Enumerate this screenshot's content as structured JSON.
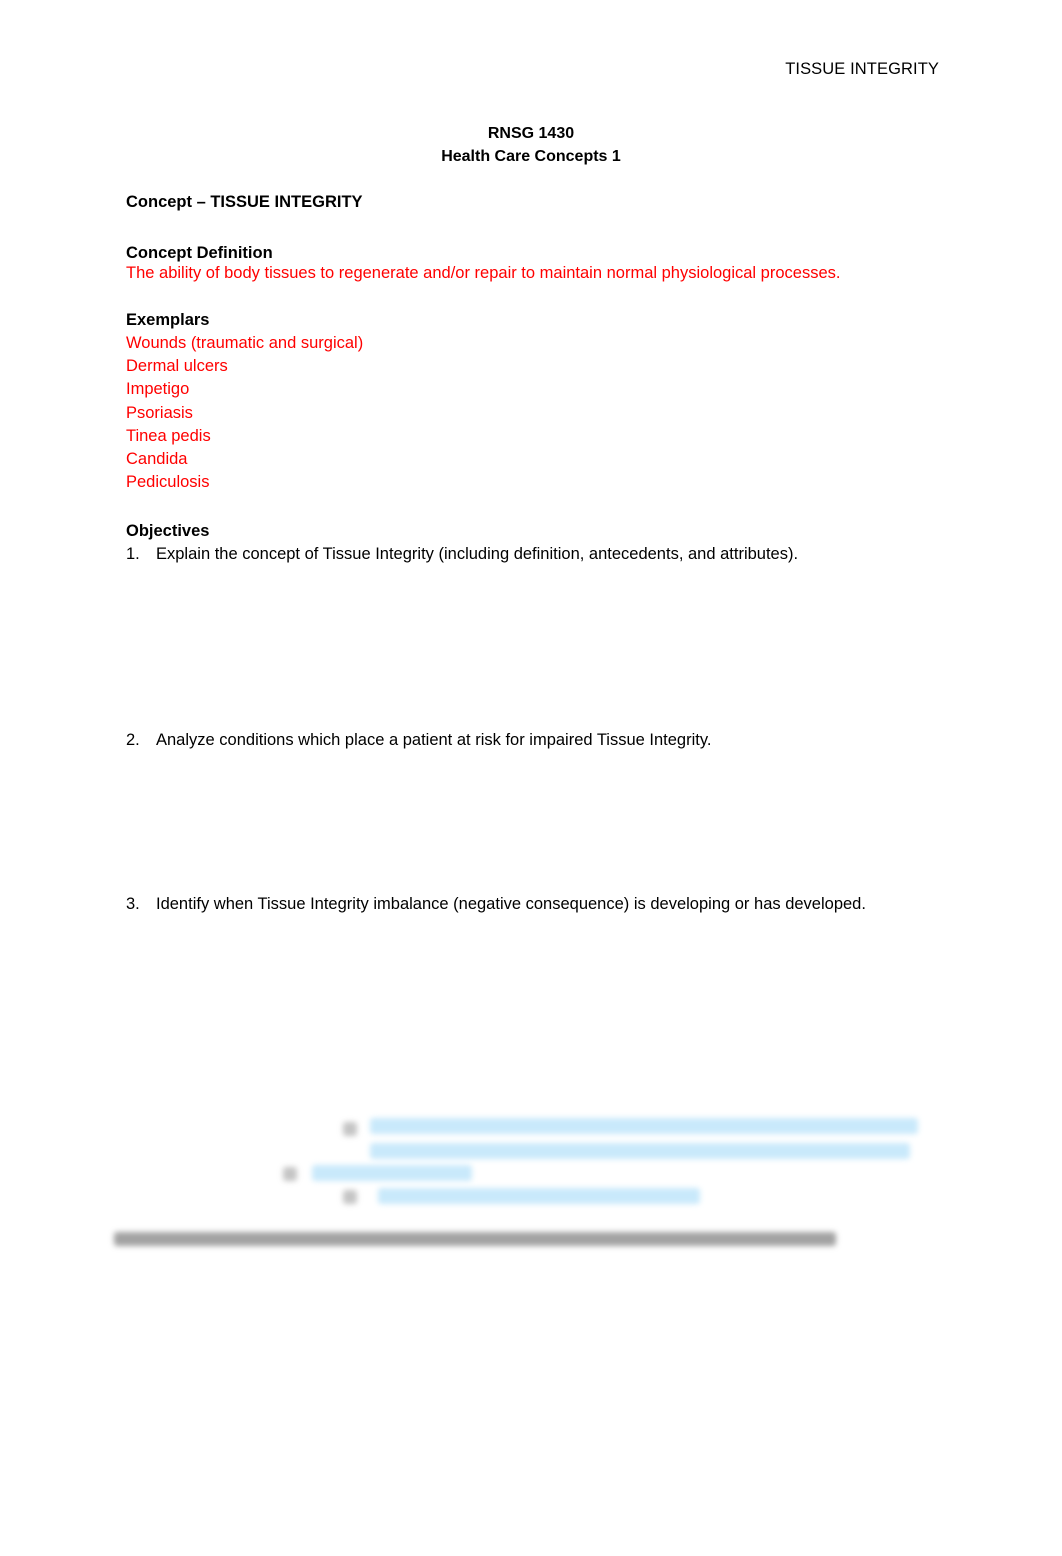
{
  "header": {
    "running_title": "TISSUE INTEGRITY"
  },
  "title": {
    "course_code": "RNSG 1430",
    "course_name": "Health Care Concepts 1"
  },
  "concept": {
    "label": "Concept – TISSUE INTEGRITY"
  },
  "definition": {
    "heading": "Concept Definition",
    "text": "The ability of body tissues to regenerate and/or repair to maintain normal physiological processes."
  },
  "exemplars": {
    "heading": "Exemplars",
    "items": [
      "Wounds (traumatic and surgical)",
      "Dermal ulcers",
      "Impetigo",
      "Psoriasis",
      "Tinea pedis",
      "Candida",
      "Pediculosis"
    ]
  },
  "objectives": {
    "heading": "Objectives",
    "items": [
      {
        "num": "1.",
        "text": "Explain the concept of Tissue Integrity (including definition, antecedents, and attributes)."
      },
      {
        "num": "2.",
        "text": "Analyze conditions which place a patient at risk for impaired Tissue Integrity."
      },
      {
        "num": "3.",
        "text": "Identify when Tissue Integrity imbalance (negative consequence) is developing or has developed."
      }
    ]
  },
  "colors": {
    "accent_red": "#ff0000",
    "blur_blue": "#c9e9fb"
  }
}
